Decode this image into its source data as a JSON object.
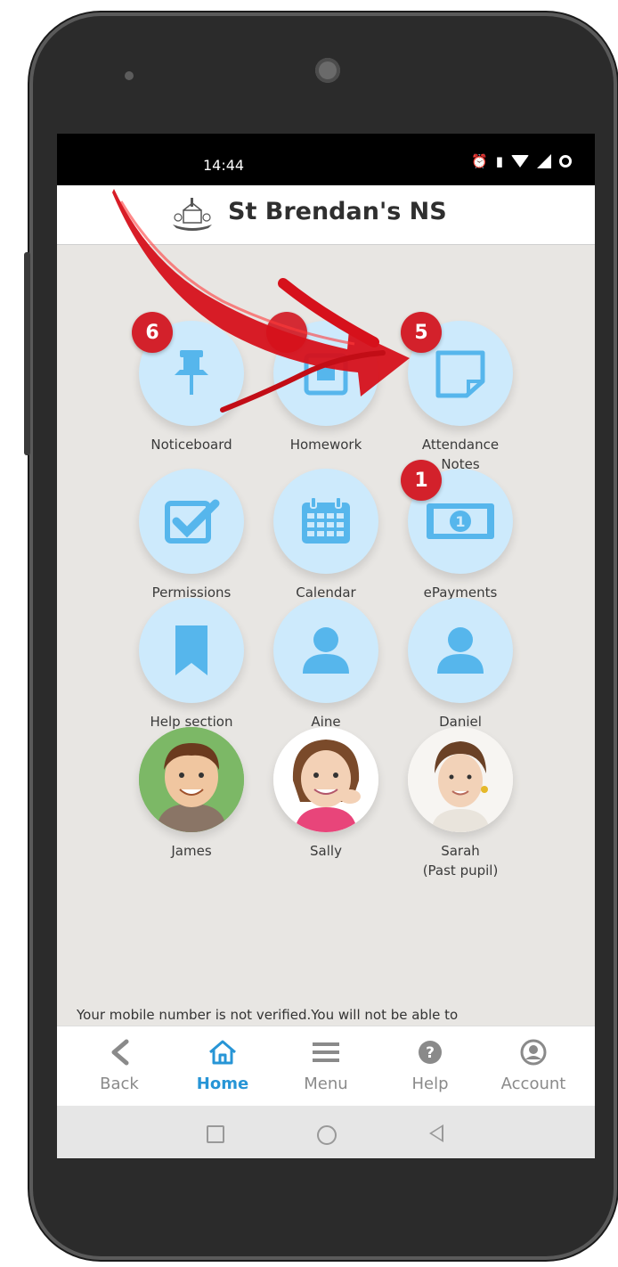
{
  "status_bar": {
    "time": "14:44"
  },
  "header": {
    "title": "St Brendan's NS"
  },
  "tiles": [
    {
      "label": "Noticeboard",
      "icon": "pushpin-icon",
      "badge": "6"
    },
    {
      "label": "Homework",
      "icon": "homework-icon",
      "badge": ""
    },
    {
      "label": "Attendance Notes",
      "icon": "note-icon",
      "badge": "5"
    },
    {
      "label": "Permissions",
      "icon": "checkbox-icon",
      "badge": ""
    },
    {
      "label": "Calendar",
      "icon": "calendar-icon",
      "badge": ""
    },
    {
      "label": "ePayments",
      "icon": "banknote-icon",
      "badge": "1"
    },
    {
      "label": "Help section",
      "icon": "bookmark-icon",
      "badge": ""
    },
    {
      "label": "Aine",
      "icon": "person-icon",
      "badge": ""
    },
    {
      "label": "Daniel",
      "icon": "person-icon",
      "badge": ""
    },
    {
      "label": "James",
      "icon": "child-photo",
      "badge": ""
    },
    {
      "label": "Sally",
      "icon": "child-photo",
      "badge": ""
    },
    {
      "label": "Sarah\n(Past pupil)",
      "icon": "child-photo",
      "badge": ""
    }
  ],
  "notice": {
    "text": "Your mobile number is not verified.You will not be able to"
  },
  "bottom_nav": {
    "items": [
      {
        "label": "Back",
        "icon": "chevron-left-icon"
      },
      {
        "label": "Home",
        "icon": "home-icon",
        "active": true
      },
      {
        "label": "Menu",
        "icon": "menu-icon"
      },
      {
        "label": "Help",
        "icon": "question-icon"
      },
      {
        "label": "Account",
        "icon": "account-icon"
      }
    ]
  },
  "colors": {
    "accent": "#2795d6",
    "badge": "#d3212b",
    "tile": "#cdeafc",
    "icon": "#56b6ec"
  }
}
